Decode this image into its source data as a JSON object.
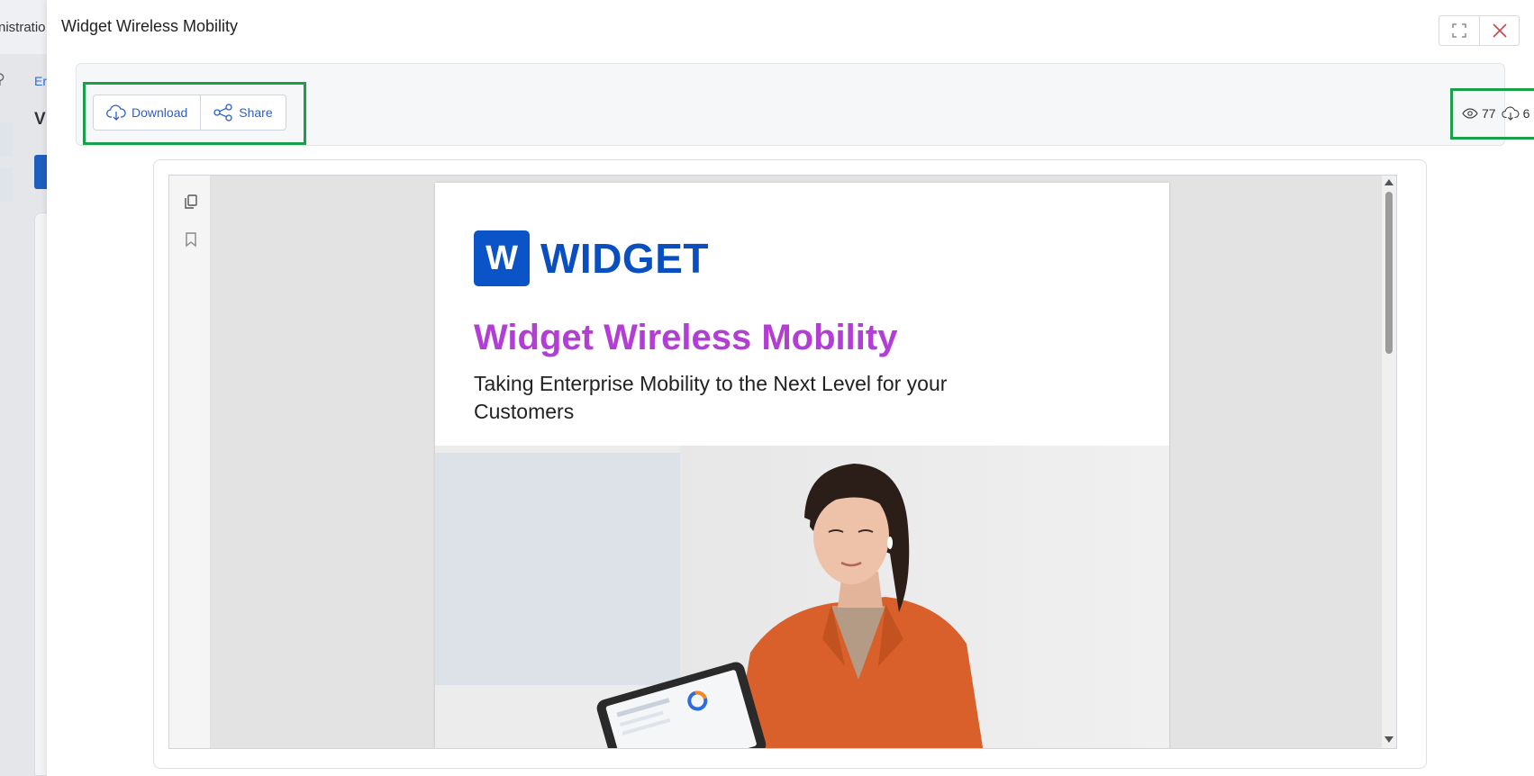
{
  "background": {
    "title_fragment": "nistratio",
    "crumb_fragment": "Er",
    "heading_fragment": "V"
  },
  "modal": {
    "title": "Widget Wireless Mobility",
    "window_buttons": {
      "maximize_icon": "maximize-icon",
      "close_icon": "close-icon"
    }
  },
  "toolbar": {
    "download_label": "Download",
    "share_label": "Share",
    "views_count": "77",
    "downloads_count": "6",
    "highlight_color": "#1aa04b"
  },
  "viewer": {
    "side_tools": [
      "pages-icon",
      "bookmark-icon"
    ]
  },
  "document": {
    "logo_letter": "W",
    "logo_text": "WIDGET",
    "title": "Widget Wireless Mobility",
    "subtitle": "Taking Enterprise Mobility to the Next Level for your Customers",
    "brand_color": "#0a54c8",
    "title_color": "#b33ed6"
  }
}
